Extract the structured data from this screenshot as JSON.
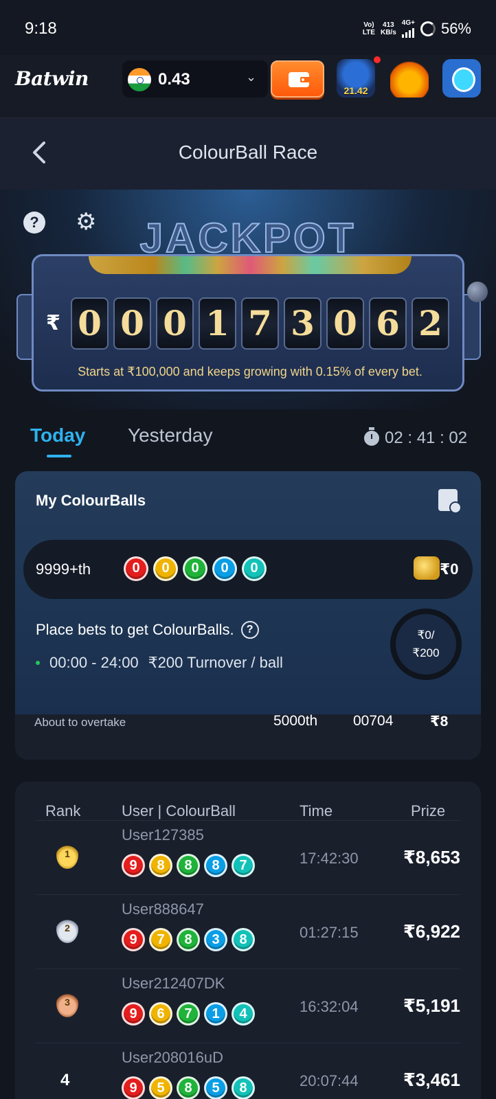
{
  "status_bar": {
    "time": "9:18",
    "network_top": "Vo)",
    "network_bottom": "LTE",
    "speed_top": "413",
    "speed_bottom": "KB/s",
    "gen": "4G+",
    "battery": "56%"
  },
  "header": {
    "logo": "Batwin",
    "balance": "0.43",
    "pot_badge": "21.42",
    "icons": [
      "india-flag-icon",
      "chevron-down-icon",
      "wallet-icon",
      "jackpot-pot-icon",
      "treasure-chest-icon",
      "profile-avatar-icon"
    ]
  },
  "page": {
    "title": "ColourBall Race"
  },
  "jackpot": {
    "title": "JACKPOT",
    "currency": "₹",
    "digits": [
      "0",
      "0",
      "0",
      "1",
      "7",
      "3",
      "0",
      "6",
      "2"
    ],
    "note": "Starts at ₹100,000 and keeps growing with 0.15% of every bet."
  },
  "tabs": {
    "today": "Today",
    "yesterday": "Yesterday",
    "countdown": "02 : 41 : 02"
  },
  "my_colourballs": {
    "title": "My ColourBalls",
    "rank": "9999+th",
    "balls": [
      "0",
      "0",
      "0",
      "0",
      "0"
    ],
    "prize": "₹0",
    "hint": "Place bets to get ColourBalls.",
    "hours": "00:00 - 24:00",
    "rule": "₹200 Turnover / ball",
    "progress_top": "₹0/",
    "progress_bottom": "₹200",
    "progress_fraction": 0,
    "overtake_label": "About to overtake",
    "overtake_rank": "5000th",
    "overtake_code": "00704",
    "overtake_prize": "₹8"
  },
  "leaderboard": {
    "headers": {
      "rank": "Rank",
      "user": "User | ColourBall",
      "time": "Time",
      "prize": "Prize"
    },
    "rows": [
      {
        "rank": "1",
        "user": "User127385",
        "balls": [
          "9",
          "8",
          "8",
          "8",
          "7"
        ],
        "time": "17:42:30",
        "prize": "₹8,653"
      },
      {
        "rank": "2",
        "user": "User888647",
        "balls": [
          "9",
          "7",
          "8",
          "3",
          "8"
        ],
        "time": "01:27:15",
        "prize": "₹6,922"
      },
      {
        "rank": "3",
        "user": "User212407DK",
        "balls": [
          "9",
          "6",
          "7",
          "1",
          "4"
        ],
        "time": "16:32:04",
        "prize": "₹5,191"
      },
      {
        "rank": "4",
        "user": "User208016uD",
        "balls": [
          "9",
          "5",
          "8",
          "5",
          "8"
        ],
        "time": "20:07:44",
        "prize": "₹3,461"
      }
    ]
  },
  "colors": {
    "accent": "#2fb2f0",
    "ball_colors": [
      "#e41d1d",
      "#f0b400",
      "#1fb33a",
      "#0a9ee6",
      "#12c2b8"
    ],
    "background": "#12161f"
  }
}
